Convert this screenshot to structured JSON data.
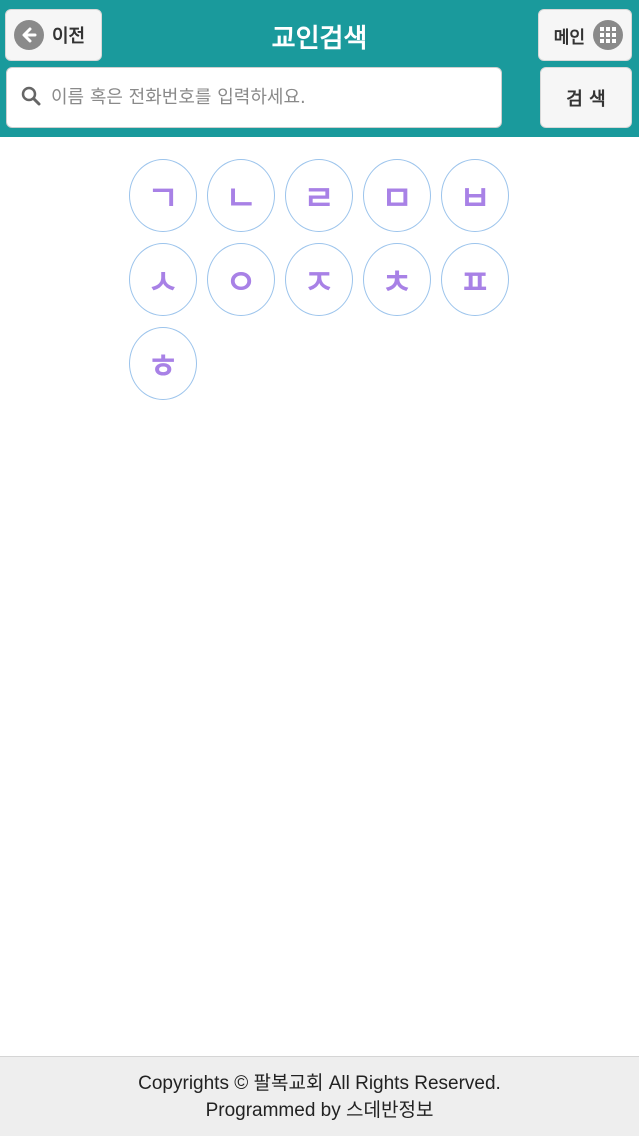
{
  "header": {
    "title": "교인검색",
    "back_label": "이전",
    "main_label": "메인",
    "background_color": "#1a9a9c"
  },
  "search": {
    "placeholder": "이름 혹은 전화번호를 입력하세요.",
    "value": "",
    "button_label": "검 색"
  },
  "consonants": [
    "ㄱ",
    "ㄴ",
    "ㄹ",
    "ㅁ",
    "ㅂ",
    "ㅅ",
    "ㅇ",
    "ㅈ",
    "ㅊ",
    "ㅍ",
    "ㅎ"
  ],
  "footer": {
    "line1": "Copyrights © 팔복교회 All Rights Reserved.",
    "line2": "Programmed by 스데반정보"
  },
  "colors": {
    "consonant_text": "#a881e6",
    "consonant_border": "#9cc4ec"
  }
}
